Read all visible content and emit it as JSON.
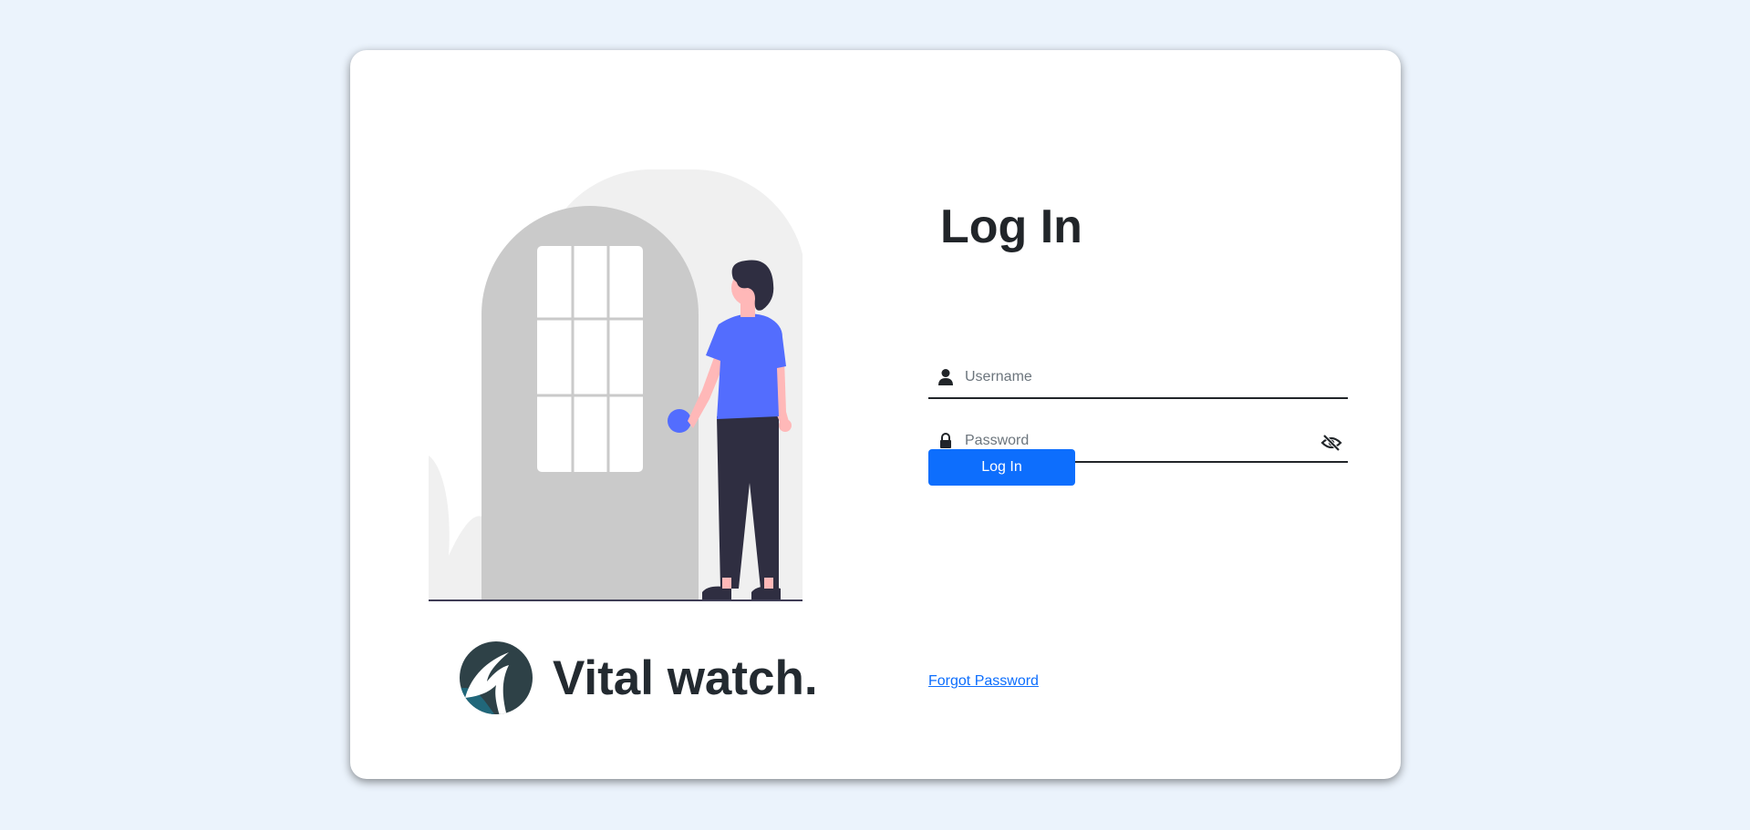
{
  "brand": {
    "name": "Vital watch.",
    "logo_icon": "vital-watch-logo-icon"
  },
  "login": {
    "title": "Log In",
    "username": {
      "placeholder": "Username",
      "value": "",
      "icon": "user-icon"
    },
    "password": {
      "placeholder": "Password",
      "value": "",
      "icon": "lock-icon",
      "toggle_icon": "eye-slash-icon"
    },
    "submit_label": "Log In",
    "forgot_password_label": "Forgot Password"
  },
  "colors": {
    "page_background": "#ebf3fc",
    "card_background": "#ffffff",
    "primary": "#0d6efd",
    "illustration_accent": "#536dfe",
    "text_dark": "#212529"
  }
}
